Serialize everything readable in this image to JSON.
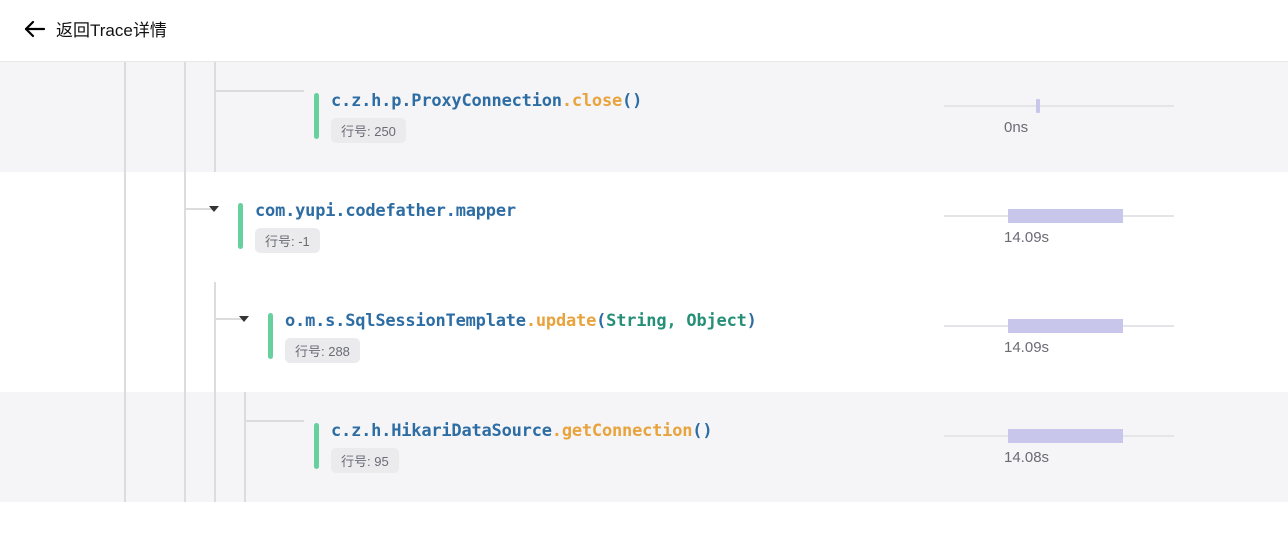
{
  "header": {
    "back_label": "返回Trace详情"
  },
  "line_label_prefix": "行号: ",
  "rows": [
    {
      "indent": 3,
      "shaded": true,
      "caret": false,
      "class": "c.z.h.p.ProxyConnection",
      "method": "close",
      "args": "",
      "line_no": "250",
      "time": "0ns",
      "bar_left_pct": 40,
      "bar_width_pct": 0
    },
    {
      "indent": 2,
      "shaded": false,
      "caret": true,
      "class": "com.yupi.codefather.mapper",
      "method": "",
      "args": "",
      "line_no": "-1",
      "time": "14.09s",
      "bar_left_pct": 28,
      "bar_width_pct": 50
    },
    {
      "indent": 3,
      "shaded": false,
      "caret": true,
      "class": "o.m.s.SqlSessionTemplate",
      "method": "update",
      "args": "String, Object",
      "line_no": "288",
      "time": "14.09s",
      "bar_left_pct": 28,
      "bar_width_pct": 50
    },
    {
      "indent": 4,
      "shaded": true,
      "caret": false,
      "class": "c.z.h.HikariDataSource",
      "method": "getConnection",
      "args": "",
      "line_no": "95",
      "time": "14.08s",
      "bar_left_pct": 28,
      "bar_width_pct": 50
    }
  ]
}
